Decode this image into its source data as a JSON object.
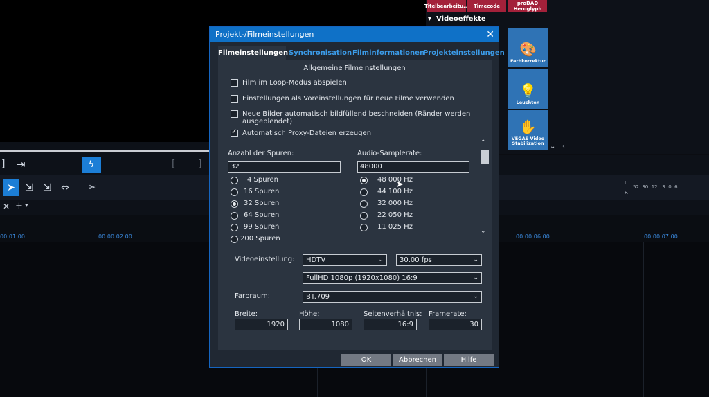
{
  "effects_panel": {
    "top_items": [
      "Titelbearbeitu...",
      "Timecode",
      "proDAD Heroglyph"
    ],
    "section_title": "Videoeffekte",
    "tiles": [
      {
        "label": "Farbkorrektur",
        "icon": "palette-icon"
      },
      {
        "label": "Leuchten",
        "icon": "lamp-icon"
      },
      {
        "label": "VEGAS Video Stabilization",
        "icon": "hand-icon"
      }
    ]
  },
  "meters": {
    "l": "L",
    "r": "R",
    "scale": "52  30  12   3  0  6"
  },
  "ruler": {
    "labels": [
      "00:01:00",
      "00:00:02:00",
      "00:00:06:00",
      "00:00:07:00"
    ]
  },
  "dialog": {
    "title": "Projekt-/Filmeinstellungen",
    "tabs": [
      "Filmeinstellungen",
      "Synchronisation",
      "Filminformationen",
      "Projekteinstellungen"
    ],
    "group_title": "Allgemeine Filmeinstellungen",
    "checkboxes": [
      {
        "label": "Film im Loop-Modus abspielen",
        "checked": false
      },
      {
        "label": "Einstellungen als Voreinstellungen für neue Filme verwenden",
        "checked": false
      },
      {
        "label": "Neue Bilder automatisch bildfüllend beschneiden (Ränder werden ausgeblendet)",
        "checked": false
      },
      {
        "label": "Automatisch Proxy-Dateien erzeugen",
        "checked": true
      }
    ],
    "tracks": {
      "label": "Anzahl der Spuren:",
      "value": "32",
      "options": [
        "4 Spuren",
        "16 Spuren",
        "32 Spuren",
        "64 Spuren",
        "99 Spuren",
        "200 Spuren"
      ],
      "selected": "32 Spuren"
    },
    "samplerate": {
      "label": "Audio-Samplerate:",
      "value": "48000",
      "options": [
        "48 000 Hz",
        "44 100 Hz",
        "32 000 Hz",
        "22 050 Hz",
        "11 025 Hz"
      ],
      "selected": "48 000 Hz"
    },
    "video": {
      "label": "Videoeinstellung:",
      "standard": "HDTV",
      "fps": "30.00 fps",
      "format": "FullHD 1080p (1920x1080) 16:9"
    },
    "colorspace": {
      "label": "Farbraum:",
      "value": "BT.709"
    },
    "dims": {
      "width_label": "Breite:",
      "width": "1920",
      "height_label": "Höhe:",
      "height": "1080",
      "aspect_label": "Seitenverhältnis:",
      "aspect": "16:9",
      "framerate_label": "Framerate:",
      "framerate": "30"
    },
    "buttons": {
      "ok": "OK",
      "cancel": "Abbrechen",
      "help": "Hilfe"
    }
  }
}
